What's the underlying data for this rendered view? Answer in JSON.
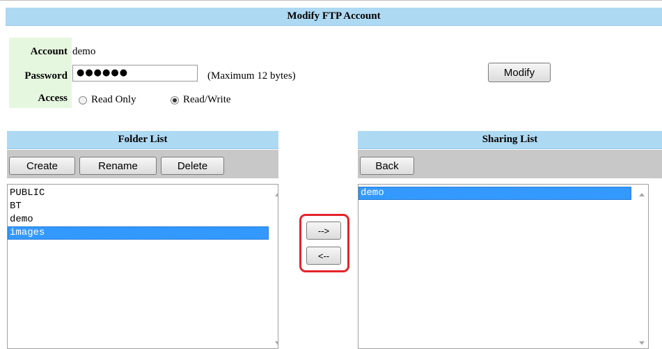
{
  "header": {
    "title": "Modify FTP Account"
  },
  "account_form": {
    "account_label": "Account",
    "account_value": "demo",
    "password_label": "Password",
    "password_value": "●●●●●●",
    "password_hint": "(Maximum 12 bytes)",
    "access_label": "Access",
    "access_options": [
      {
        "label": "Read Only",
        "checked": false
      },
      {
        "label": "Read/Write",
        "checked": true
      }
    ],
    "modify_button": "Modify"
  },
  "folder_panel": {
    "title": "Folder List",
    "buttons": {
      "create": "Create",
      "rename": "Rename",
      "delete": "Delete"
    },
    "items": [
      {
        "label": "PUBLIC",
        "selected": false
      },
      {
        "label": "BT",
        "selected": false
      },
      {
        "label": "demo",
        "selected": false
      },
      {
        "label": "images",
        "selected": true
      }
    ]
  },
  "transfer": {
    "add": "-->",
    "remove": "<--"
  },
  "sharing_panel": {
    "title": "Sharing List",
    "buttons": {
      "back": "Back"
    },
    "items": [
      {
        "label": "demo",
        "selected": true
      }
    ]
  },
  "colors": {
    "header_bg": "#aed9f2",
    "label_bg": "#e6f7e0",
    "toolbar_bg": "#c8c8c8",
    "selection": "#3399ff",
    "annotation": "#e3242b"
  }
}
